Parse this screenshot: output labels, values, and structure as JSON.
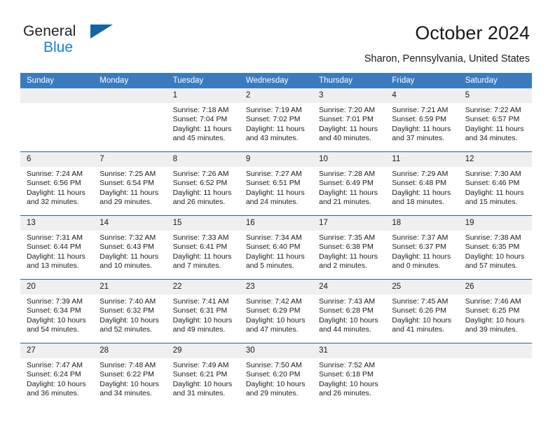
{
  "brand": {
    "logo_line1": "General",
    "logo_line2": "Blue",
    "logo_icon": "triangle-icon",
    "accent_color": "#1a7fd4",
    "triangle_color": "#1263a8"
  },
  "header": {
    "title": "October 2024",
    "subtitle": "Sharon, Pennsylvania, United States"
  },
  "calendar": {
    "header_background": "#3a7bc0",
    "daynum_background": "#efefef",
    "row_divider_color": "#2a6099",
    "weekday_headers": [
      "Sunday",
      "Monday",
      "Tuesday",
      "Wednesday",
      "Thursday",
      "Friday",
      "Saturday"
    ],
    "weeks": [
      [
        {
          "day": "",
          "sunrise": "",
          "sunset": "",
          "daylight": ""
        },
        {
          "day": "",
          "sunrise": "",
          "sunset": "",
          "daylight": ""
        },
        {
          "day": "1",
          "sunrise": "Sunrise: 7:18 AM",
          "sunset": "Sunset: 7:04 PM",
          "daylight": "Daylight: 11 hours and 45 minutes."
        },
        {
          "day": "2",
          "sunrise": "Sunrise: 7:19 AM",
          "sunset": "Sunset: 7:02 PM",
          "daylight": "Daylight: 11 hours and 43 minutes."
        },
        {
          "day": "3",
          "sunrise": "Sunrise: 7:20 AM",
          "sunset": "Sunset: 7:01 PM",
          "daylight": "Daylight: 11 hours and 40 minutes."
        },
        {
          "day": "4",
          "sunrise": "Sunrise: 7:21 AM",
          "sunset": "Sunset: 6:59 PM",
          "daylight": "Daylight: 11 hours and 37 minutes."
        },
        {
          "day": "5",
          "sunrise": "Sunrise: 7:22 AM",
          "sunset": "Sunset: 6:57 PM",
          "daylight": "Daylight: 11 hours and 34 minutes."
        }
      ],
      [
        {
          "day": "6",
          "sunrise": "Sunrise: 7:24 AM",
          "sunset": "Sunset: 6:56 PM",
          "daylight": "Daylight: 11 hours and 32 minutes."
        },
        {
          "day": "7",
          "sunrise": "Sunrise: 7:25 AM",
          "sunset": "Sunset: 6:54 PM",
          "daylight": "Daylight: 11 hours and 29 minutes."
        },
        {
          "day": "8",
          "sunrise": "Sunrise: 7:26 AM",
          "sunset": "Sunset: 6:52 PM",
          "daylight": "Daylight: 11 hours and 26 minutes."
        },
        {
          "day": "9",
          "sunrise": "Sunrise: 7:27 AM",
          "sunset": "Sunset: 6:51 PM",
          "daylight": "Daylight: 11 hours and 24 minutes."
        },
        {
          "day": "10",
          "sunrise": "Sunrise: 7:28 AM",
          "sunset": "Sunset: 6:49 PM",
          "daylight": "Daylight: 11 hours and 21 minutes."
        },
        {
          "day": "11",
          "sunrise": "Sunrise: 7:29 AM",
          "sunset": "Sunset: 6:48 PM",
          "daylight": "Daylight: 11 hours and 18 minutes."
        },
        {
          "day": "12",
          "sunrise": "Sunrise: 7:30 AM",
          "sunset": "Sunset: 6:46 PM",
          "daylight": "Daylight: 11 hours and 15 minutes."
        }
      ],
      [
        {
          "day": "13",
          "sunrise": "Sunrise: 7:31 AM",
          "sunset": "Sunset: 6:44 PM",
          "daylight": "Daylight: 11 hours and 13 minutes."
        },
        {
          "day": "14",
          "sunrise": "Sunrise: 7:32 AM",
          "sunset": "Sunset: 6:43 PM",
          "daylight": "Daylight: 11 hours and 10 minutes."
        },
        {
          "day": "15",
          "sunrise": "Sunrise: 7:33 AM",
          "sunset": "Sunset: 6:41 PM",
          "daylight": "Daylight: 11 hours and 7 minutes."
        },
        {
          "day": "16",
          "sunrise": "Sunrise: 7:34 AM",
          "sunset": "Sunset: 6:40 PM",
          "daylight": "Daylight: 11 hours and 5 minutes."
        },
        {
          "day": "17",
          "sunrise": "Sunrise: 7:35 AM",
          "sunset": "Sunset: 6:38 PM",
          "daylight": "Daylight: 11 hours and 2 minutes."
        },
        {
          "day": "18",
          "sunrise": "Sunrise: 7:37 AM",
          "sunset": "Sunset: 6:37 PM",
          "daylight": "Daylight: 11 hours and 0 minutes."
        },
        {
          "day": "19",
          "sunrise": "Sunrise: 7:38 AM",
          "sunset": "Sunset: 6:35 PM",
          "daylight": "Daylight: 10 hours and 57 minutes."
        }
      ],
      [
        {
          "day": "20",
          "sunrise": "Sunrise: 7:39 AM",
          "sunset": "Sunset: 6:34 PM",
          "daylight": "Daylight: 10 hours and 54 minutes."
        },
        {
          "day": "21",
          "sunrise": "Sunrise: 7:40 AM",
          "sunset": "Sunset: 6:32 PM",
          "daylight": "Daylight: 10 hours and 52 minutes."
        },
        {
          "day": "22",
          "sunrise": "Sunrise: 7:41 AM",
          "sunset": "Sunset: 6:31 PM",
          "daylight": "Daylight: 10 hours and 49 minutes."
        },
        {
          "day": "23",
          "sunrise": "Sunrise: 7:42 AM",
          "sunset": "Sunset: 6:29 PM",
          "daylight": "Daylight: 10 hours and 47 minutes."
        },
        {
          "day": "24",
          "sunrise": "Sunrise: 7:43 AM",
          "sunset": "Sunset: 6:28 PM",
          "daylight": "Daylight: 10 hours and 44 minutes."
        },
        {
          "day": "25",
          "sunrise": "Sunrise: 7:45 AM",
          "sunset": "Sunset: 6:26 PM",
          "daylight": "Daylight: 10 hours and 41 minutes."
        },
        {
          "day": "26",
          "sunrise": "Sunrise: 7:46 AM",
          "sunset": "Sunset: 6:25 PM",
          "daylight": "Daylight: 10 hours and 39 minutes."
        }
      ],
      [
        {
          "day": "27",
          "sunrise": "Sunrise: 7:47 AM",
          "sunset": "Sunset: 6:24 PM",
          "daylight": "Daylight: 10 hours and 36 minutes."
        },
        {
          "day": "28",
          "sunrise": "Sunrise: 7:48 AM",
          "sunset": "Sunset: 6:22 PM",
          "daylight": "Daylight: 10 hours and 34 minutes."
        },
        {
          "day": "29",
          "sunrise": "Sunrise: 7:49 AM",
          "sunset": "Sunset: 6:21 PM",
          "daylight": "Daylight: 10 hours and 31 minutes."
        },
        {
          "day": "30",
          "sunrise": "Sunrise: 7:50 AM",
          "sunset": "Sunset: 6:20 PM",
          "daylight": "Daylight: 10 hours and 29 minutes."
        },
        {
          "day": "31",
          "sunrise": "Sunrise: 7:52 AM",
          "sunset": "Sunset: 6:18 PM",
          "daylight": "Daylight: 10 hours and 26 minutes."
        },
        {
          "day": "",
          "sunrise": "",
          "sunset": "",
          "daylight": ""
        },
        {
          "day": "",
          "sunrise": "",
          "sunset": "",
          "daylight": ""
        }
      ]
    ]
  }
}
